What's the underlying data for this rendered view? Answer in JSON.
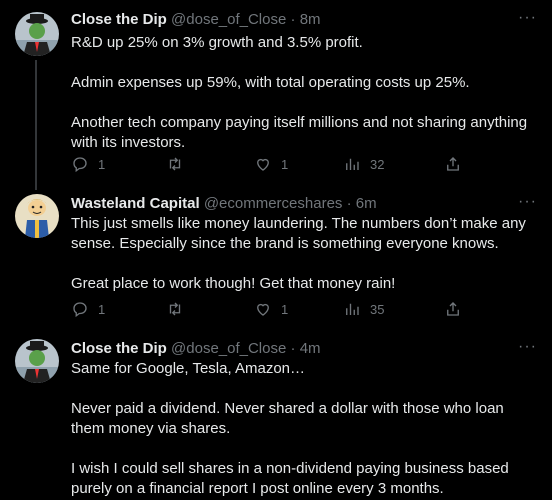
{
  "tweets": [
    {
      "name": "Close the Dip",
      "handle": "@dose_of_Close",
      "dot": "·",
      "time": "8m",
      "more": "···",
      "paragraphs": [
        "R&D up 25% on 3% growth and 3.5% profit.",
        "Admin expenses up 59%, with total operating costs up 25%.",
        "Another tech company paying itself millions and not sharing anything with its investors."
      ],
      "replies": "1",
      "retweets": "",
      "likes": "1",
      "views": "32"
    },
    {
      "name": "Wasteland Capital",
      "handle": "@ecommerceshares",
      "dot": "·",
      "time": "6m",
      "more": "···",
      "paragraphs": [
        "This just smells like money laundering. The numbers don’t make any sense. Especially since the brand is something everyone knows.",
        "Great place to work though! Get that money rain!"
      ],
      "replies": "1",
      "retweets": "",
      "likes": "1",
      "views": "35"
    },
    {
      "name": "Close the Dip",
      "handle": "@dose_of_Close",
      "dot": "·",
      "time": "4m",
      "more": "···",
      "paragraphs": [
        "Same for Google, Tesla, Amazon…",
        "Never paid a dividend.  Never shared a dollar with those who loan them money via shares.",
        "I wish I could sell shares in a non-dividend paying business based purely on a financial report I post online every 3 months."
      ]
    }
  ],
  "colors": {
    "background": "#000000",
    "text": "#e7e9ea",
    "muted": "#71767b",
    "thread_line": "#333639"
  }
}
